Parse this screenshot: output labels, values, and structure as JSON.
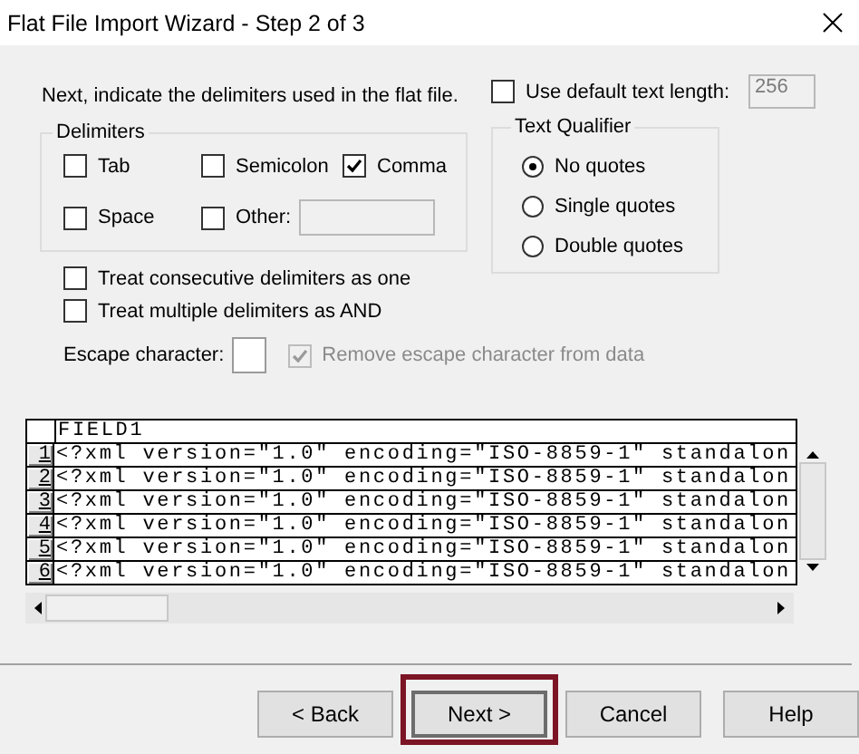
{
  "window": {
    "title": "Flat File Import Wizard - Step 2 of 3"
  },
  "instructions": "Next, indicate the delimiters used in the flat file.",
  "default_text_length": {
    "label": "Use default text length:",
    "checked": false,
    "value": "256"
  },
  "delimiters": {
    "title": "Delimiters",
    "options": [
      {
        "label": "Tab",
        "checked": false,
        "kind": "plain"
      },
      {
        "label": "Semicolon",
        "checked": false,
        "kind": "plain"
      },
      {
        "label": "Comma",
        "checked": true,
        "kind": "plain"
      },
      {
        "label": "Space",
        "checked": false,
        "kind": "plain"
      },
      {
        "label": "Other:",
        "checked": false,
        "kind": "other"
      }
    ]
  },
  "text_qualifier": {
    "title": "Text Qualifier",
    "options": [
      {
        "label": "No quotes",
        "selected": true
      },
      {
        "label": "Single quotes",
        "selected": false
      },
      {
        "label": "Double quotes",
        "selected": false
      }
    ]
  },
  "options": [
    {
      "label": "Treat consecutive delimiters as one",
      "checked": false
    },
    {
      "label": "Treat multiple delimiters as AND",
      "checked": false
    }
  ],
  "escape": {
    "label": "Escape character:",
    "remove_label": "Remove escape character from data",
    "remove_checked": true,
    "remove_disabled": true
  },
  "preview": {
    "columns": [
      "FIELD1"
    ],
    "rows": [
      {
        "number": "1",
        "cells": [
          "<?xml version=\"1.0\" encoding=\"ISO-8859-1\" standalon"
        ]
      },
      {
        "number": "2",
        "cells": [
          "<?xml version=\"1.0\" encoding=\"ISO-8859-1\" standalon"
        ]
      },
      {
        "number": "3",
        "cells": [
          "<?xml version=\"1.0\" encoding=\"ISO-8859-1\" standalon"
        ]
      },
      {
        "number": "4",
        "cells": [
          "<?xml version=\"1.0\" encoding=\"ISO-8859-1\" standalon"
        ]
      },
      {
        "number": "5",
        "cells": [
          "<?xml version=\"1.0\" encoding=\"ISO-8859-1\" standalon"
        ]
      },
      {
        "number": "6",
        "cells": [
          "<?xml version=\"1.0\" encoding=\"ISO-8859-1\" standalon"
        ]
      }
    ]
  },
  "buttons": [
    {
      "label": "< Back",
      "default": false,
      "highlighted": false
    },
    {
      "label": "Next >",
      "default": true,
      "highlighted": true
    },
    {
      "label": "Cancel",
      "default": false,
      "highlighted": false
    },
    {
      "label": "Help",
      "default": false,
      "highlighted": false
    }
  ]
}
